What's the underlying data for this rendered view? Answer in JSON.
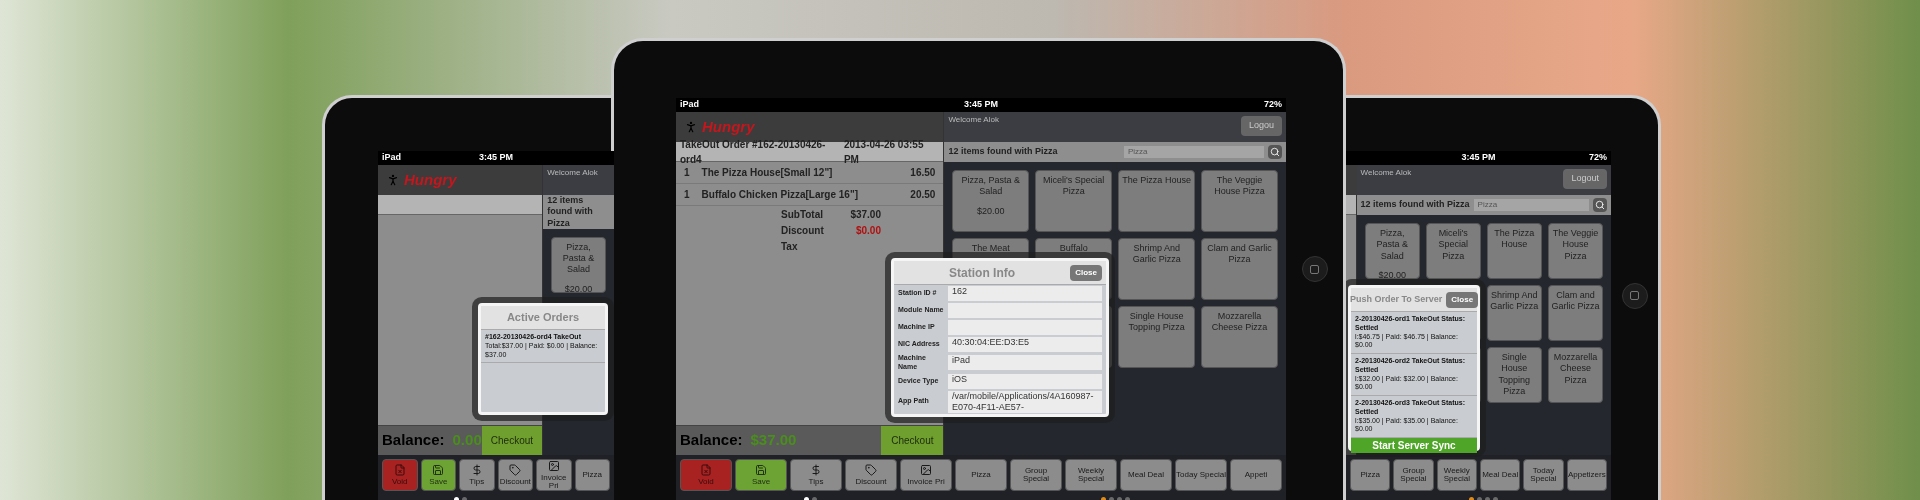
{
  "tablets": [
    {
      "kind": "side-left",
      "status": {
        "carrier": "iPad",
        "time": "3:45 PM"
      },
      "brand": "Hungry",
      "welcome": "Welcome Alok",
      "search": {
        "result": "12 items found with Pizza"
      },
      "tile_rows": [
        {
          "tiles": [
            {
              "label": "Pizza, Pasta & Salad",
              "price": "$20.00"
            }
          ]
        }
      ],
      "dialog": {
        "title": "Active Orders",
        "entries": [
          {
            "title": "#162-20130426-ord4 TakeOut",
            "detail": "Total:$37.00 | Paid: $0.00 | Balance: $37.00"
          }
        ]
      },
      "balance": {
        "label": "Balance:",
        "amount": "0.00",
        "checkout": "Checkout"
      },
      "toolbar": [
        {
          "kind": "void",
          "label": "Void"
        },
        {
          "kind": "save",
          "label": "Save"
        },
        {
          "kind": "tips",
          "label": "Tips"
        },
        {
          "kind": "discount",
          "label": "Discount"
        },
        {
          "kind": "invoice",
          "label": "Invoice Pri"
        },
        {
          "kind": "category",
          "label": "Pizza"
        }
      ],
      "order_dots": [
        {
          "selected": true
        },
        {
          "selected": false
        }
      ]
    },
    {
      "kind": "center",
      "status": {
        "carrier": "iPad",
        "time": "3:45 PM",
        "battery": "72%"
      },
      "brand": "Hungry",
      "welcome": "Welcome Alok",
      "logout": "Logou",
      "order": {
        "title": "TakeOut Order #162-20130426-ord4",
        "date": "2013-04-26 03:55 PM",
        "items": [
          {
            "qty": "1",
            "name": "The Pizza House[Small 12\"]",
            "price": "16.50"
          },
          {
            "qty": "1",
            "name": "Buffalo Chicken Pizza[Large 16\"]",
            "price": "20.50"
          }
        ],
        "totals": [
          {
            "kind": "plain",
            "label": "SubTotal",
            "value": "$37.00"
          },
          {
            "kind": "discount",
            "label": "Discount",
            "value": "$0.00"
          },
          {
            "label": "Tax"
          }
        ]
      },
      "search": {
        "result": "12 items found with Pizza",
        "query": "Pizza"
      },
      "tile_rows": [
        {
          "tiles": [
            {
              "label": "Pizza, Pasta & Salad",
              "price": "$20.00"
            },
            {
              "label": "Miceli's Special Pizza"
            },
            {
              "label": "The Pizza House"
            },
            {
              "label": "The Veggie House Pizza"
            }
          ]
        },
        {
          "tiles": [
            {
              "label": "The Meat"
            },
            {
              "label": "Buffalo"
            },
            {
              "label": "Shrimp And Garlic Pizza"
            },
            {
              "label": "Clam and Garlic Pizza"
            }
          ]
        },
        {
          "tiles": [
            {
              "label": "Single House Topping Pizza"
            },
            {
              "label": "Mozzarella Cheese Pizza"
            }
          ]
        }
      ],
      "dialog": {
        "title": "Station Info",
        "close": "Close",
        "fields": [
          {
            "label": "Station ID #",
            "value": "162"
          },
          {
            "label": "Module Name"
          },
          {
            "label": "Machine IP"
          },
          {
            "label": "NIC Address",
            "value": "40:30:04:EE:D3:E5"
          },
          {
            "label": "Machine Name",
            "value": "iPad"
          },
          {
            "label": "Device Type",
            "value": "iOS"
          },
          {
            "label": "App Path",
            "value": "/var/mobile/Applications/4A160987-E070-4F11-AE57-"
          }
        ]
      },
      "balance": {
        "label": "Balance:",
        "amount": "$37.00",
        "checkout": "Checkout"
      },
      "toolbar": [
        {
          "kind": "void",
          "label": "Void"
        },
        {
          "kind": "save",
          "label": "Save"
        },
        {
          "kind": "tips",
          "label": "Tips"
        },
        {
          "kind": "discount",
          "label": "Discount"
        },
        {
          "kind": "invoice",
          "label": "Invoice Pri"
        },
        {
          "kind": "category",
          "label": "Pizza"
        },
        {
          "kind": "category",
          "label": "Group Special"
        },
        {
          "kind": "category",
          "label": "Weekly Special"
        },
        {
          "kind": "category",
          "label": "Meal Deal"
        },
        {
          "kind": "category",
          "label": "Today Special"
        },
        {
          "kind": "category",
          "label": "Appeti"
        }
      ],
      "order_dots": [
        {
          "selected": true
        },
        {
          "selected": false
        }
      ],
      "menu_dots": [
        {
          "selected": true
        },
        {
          "selected": false
        },
        {
          "selected": false
        },
        {
          "selected": false
        }
      ]
    },
    {
      "kind": "side-right",
      "status": {
        "time": "3:45 PM",
        "battery": "72%"
      },
      "welcome": "Welcome Alok",
      "logout": "Logout",
      "search": {
        "result": "12 items found with Pizza",
        "query": "Pizza"
      },
      "tile_rows": [
        {
          "tiles": [
            {
              "label": "Pizza, Pasta & Salad",
              "price": "$20.00"
            },
            {
              "label": "Miceli's Special Pizza"
            },
            {
              "label": "The Pizza House"
            },
            {
              "label": "The Veggie House Pizza"
            }
          ]
        },
        {
          "tiles": [
            {
              "label": "Shrimp And Garlic Pizza"
            },
            {
              "label": "Clam and Garlic Pizza"
            }
          ]
        },
        {
          "tiles": [
            {
              "label": "Single House Topping Pizza"
            },
            {
              "label": "Mozzarella Cheese Pizza"
            }
          ]
        }
      ],
      "dialog": {
        "title": "Push Order To Server",
        "close": "Close",
        "entries": [
          {
            "title": "2-20130426-ord1 TakeOut Status: Settled",
            "detail": "l:$46.75 | Paid: $46.75 | Balance: $0.00"
          },
          {
            "title": "2-20130426-ord2 TakeOut Status: Settled",
            "detail": "l:$32.00 | Paid: $32.00 | Balance: $0.00"
          },
          {
            "title": "2-20130426-ord3 TakeOut Status: Settled",
            "detail": "l:$35.00 | Paid: $35.00 | Balance: $0.00"
          }
        ],
        "action": "Start Server Sync"
      },
      "toolbar": [
        {
          "kind": "category",
          "label": "Pizza"
        },
        {
          "kind": "category",
          "label": "Group Special"
        },
        {
          "kind": "category",
          "label": "Weekly Special"
        },
        {
          "kind": "category",
          "label": "Meal Deal"
        },
        {
          "kind": "category",
          "label": "Today Special"
        },
        {
          "kind": "category",
          "label": "Appetizers"
        }
      ],
      "menu_dots": [
        {
          "selected": true
        },
        {
          "selected": false
        },
        {
          "selected": false
        },
        {
          "selected": false
        }
      ]
    }
  ]
}
